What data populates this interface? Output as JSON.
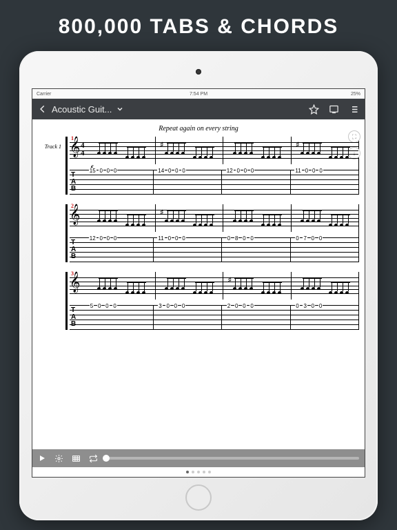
{
  "promo": {
    "headline": "800,000 TABS & CHORDS"
  },
  "status": {
    "carrier": "Carrier",
    "wifi_icon": "wifi",
    "time": "7:54 PM",
    "battery": "25%"
  },
  "appbar": {
    "title": "Acoustic Guit...",
    "icons": {
      "back": "arrow-left",
      "dropdown": "chevron-down",
      "favorite": "star",
      "display": "fullscreen",
      "list": "list"
    }
  },
  "score": {
    "caption": "Repeat again on every string",
    "dynamic": "f",
    "time_signature": {
      "top": "4",
      "bottom": "4"
    },
    "systems": [
      {
        "bar_start": 1,
        "track_label": "Track 1",
        "show_timesig": true,
        "bars": [
          {
            "accidental": null,
            "tab_top": [
              "15",
              "0",
              "0",
              "0"
            ]
          },
          {
            "accidental": "♯",
            "tab_top": [
              "14",
              "0",
              "0",
              "0"
            ]
          },
          {
            "accidental": null,
            "tab_top": [
              "12",
              "0",
              "0",
              "0"
            ]
          },
          {
            "accidental": "♯",
            "tab_top": [
              "11",
              "0",
              "0",
              "0"
            ]
          }
        ]
      },
      {
        "bar_start": 2,
        "track_label": "",
        "show_timesig": false,
        "bars": [
          {
            "accidental": null,
            "tab_top": [
              "12",
              "0",
              "0",
              "0"
            ]
          },
          {
            "accidental": "♯",
            "tab_top": [
              "11",
              "0",
              "0",
              "0"
            ]
          },
          {
            "accidental": null,
            "tab_top": [
              "0",
              "8",
              "0",
              "0"
            ]
          },
          {
            "accidental": null,
            "tab_top": [
              "0",
              "7",
              "0",
              "0"
            ]
          }
        ]
      },
      {
        "bar_start": 3,
        "track_label": "",
        "show_timesig": false,
        "bars": [
          {
            "accidental": null,
            "tab_top": [
              "5",
              "0",
              "0",
              "0"
            ]
          },
          {
            "accidental": null,
            "tab_top": [
              "3",
              "0",
              "0",
              "0"
            ]
          },
          {
            "accidental": "♯",
            "tab_top": [
              "2",
              "0",
              "0",
              "0"
            ]
          },
          {
            "accidental": null,
            "tab_top": [
              "0",
              "3",
              "0",
              "0"
            ]
          }
        ]
      }
    ],
    "float_buttons": {
      "expand": "⛶",
      "download": "↓"
    },
    "tab_clef": "T\nA\nB"
  },
  "playback": {
    "icons": {
      "play": "play",
      "settings": "gear",
      "fretboard": "grid",
      "loop": "loop"
    },
    "progress": 0
  },
  "pagination": {
    "count": 5,
    "active": 0
  }
}
